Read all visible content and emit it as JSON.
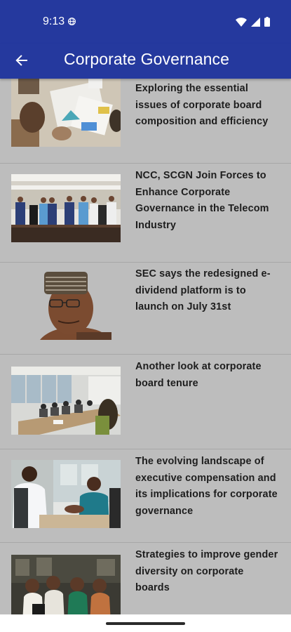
{
  "status_bar": {
    "time": "9:13",
    "icons": [
      "globe-icon",
      "wifi-icon",
      "cell-signal-icon",
      "battery-icon"
    ]
  },
  "app_bar": {
    "title": "Corporate Governance",
    "back_icon": "arrow-back-icon"
  },
  "articles": [
    {
      "headline": "Exploring the essential issues of corporate board composition and efficiency",
      "thumbnail": "people-reviewing-charts-on-table"
    },
    {
      "headline": "NCC, SCGN Join Forces to Enhance Corporate Governance in the Telecom Industry",
      "thumbnail": "group-photo-at-conference-table"
    },
    {
      "headline": "SEC says the redesigned e-dividend platform is to launch on July 31st",
      "thumbnail": "portrait-man-in-cap-and-glasses"
    },
    {
      "headline": "Another look at corporate board tenure",
      "thumbnail": "boardroom-meeting"
    },
    {
      "headline": "The evolving landscape of executive compensation and its implications for corporate governance",
      "thumbnail": "two-people-shaking-hands"
    },
    {
      "headline": "Strategies to improve gender diversity on corporate boards",
      "thumbnail": "group-of-professional-women"
    }
  ],
  "colors": {
    "primary": "#25399e",
    "background": "#bdbdbd",
    "text": "#1d1d1d"
  }
}
